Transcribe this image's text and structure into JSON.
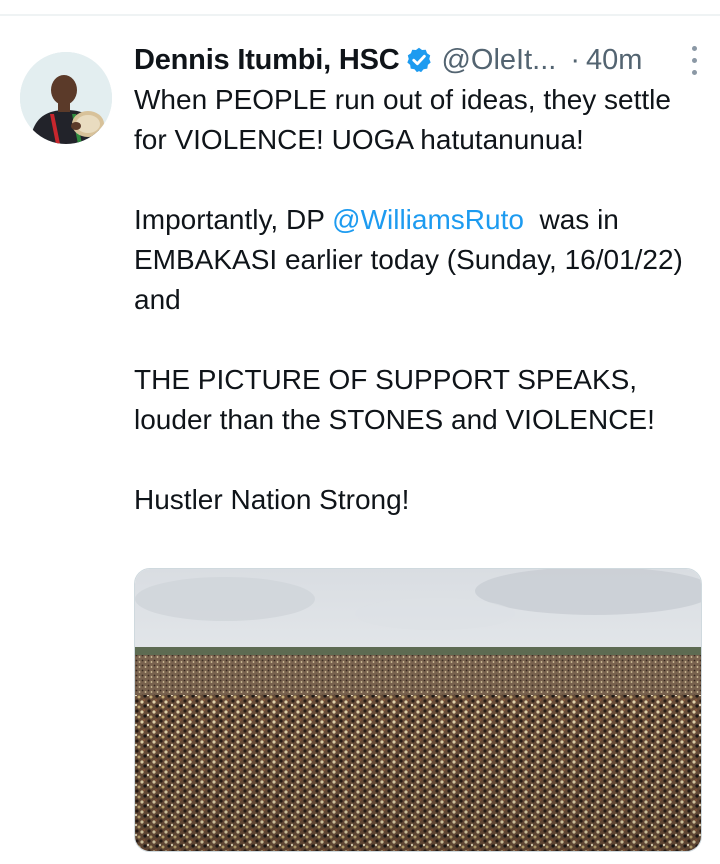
{
  "tweet": {
    "display_name": "Dennis Itumbi, HSC",
    "handle": "@OleIt...",
    "separator": "·",
    "time": "40m",
    "icons": {
      "verified": "verified-badge-icon",
      "more": "more-options-icon"
    },
    "text": {
      "line1": "When PEOPLE run out of ideas, they settle for VIOLENCE! UOGA hatutanunua!",
      "line2_before": "Importantly, DP ",
      "line2_mention": "@WilliamsRuto",
      "line2_after": "  was in EMBAKASI earlier today (Sunday, 16/01/22) and",
      "line3": "THE PICTURE OF SUPPORT SPEAKS, louder than the STONES and VIOLENCE!",
      "line4": "Hustler Nation Strong!"
    },
    "colors": {
      "verified": "#1d9bf0",
      "mention": "#1d9bf0",
      "secondary_text": "#536471"
    }
  }
}
